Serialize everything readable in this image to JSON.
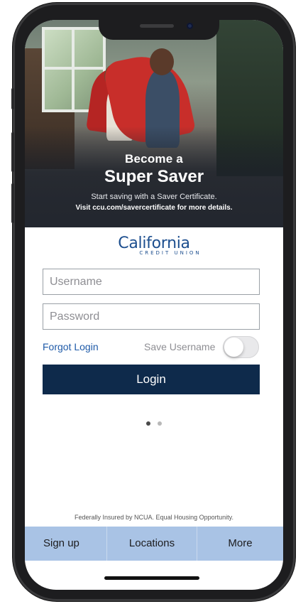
{
  "banner": {
    "line1": "Become a",
    "line2": "Super Saver",
    "line3": "Start saving with a Saver Certificate.",
    "line4": "Visit ccu.com/savercertificate for more details."
  },
  "brand": {
    "name": "California",
    "subtitle": "CREDIT UNION",
    "color": "#1d4f8f"
  },
  "login": {
    "username_placeholder": "Username",
    "password_placeholder": "Password",
    "forgot_label": "Forgot Login",
    "save_username_label": "Save Username",
    "save_username_on": false,
    "login_button": "Login",
    "button_color": "#0e2a4b"
  },
  "carousel": {
    "pages": 2,
    "current": 1
  },
  "footer": {
    "disclaimer": "Federally Insured by NCUA. Equal Housing Opportunity.",
    "tabs": [
      {
        "label": "Sign up"
      },
      {
        "label": "Locations"
      },
      {
        "label": "More"
      }
    ]
  }
}
